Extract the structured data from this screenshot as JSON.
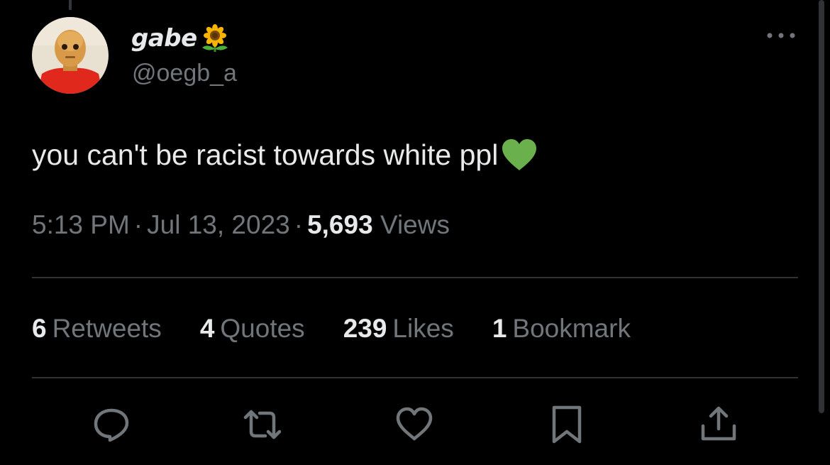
{
  "tweet": {
    "author": {
      "display_name": "gabe",
      "handle": "@oegb_a",
      "name_emoji_icon": "sunflower-icon",
      "avatar_icon": "avatar"
    },
    "text": "you can't be racist towards white ppl",
    "text_emoji_icon": "green-heart-icon",
    "time": "5:13 PM",
    "date": "Jul 13, 2023",
    "views_count": "5,693",
    "views_label": "Views",
    "separator": "·"
  },
  "stats": [
    {
      "count": "6",
      "label": "Retweets"
    },
    {
      "count": "4",
      "label": "Quotes"
    },
    {
      "count": "239",
      "label": "Likes"
    },
    {
      "count": "1",
      "label": "Bookmark"
    }
  ],
  "actions": [
    "reply-icon",
    "retweet-icon",
    "like-icon",
    "bookmark-icon",
    "share-icon"
  ],
  "colors": {
    "background": "#000000",
    "text_primary": "#e7e9ea",
    "text_secondary": "#71767b",
    "divider": "#2f3336",
    "heart": "#6ab04c"
  }
}
